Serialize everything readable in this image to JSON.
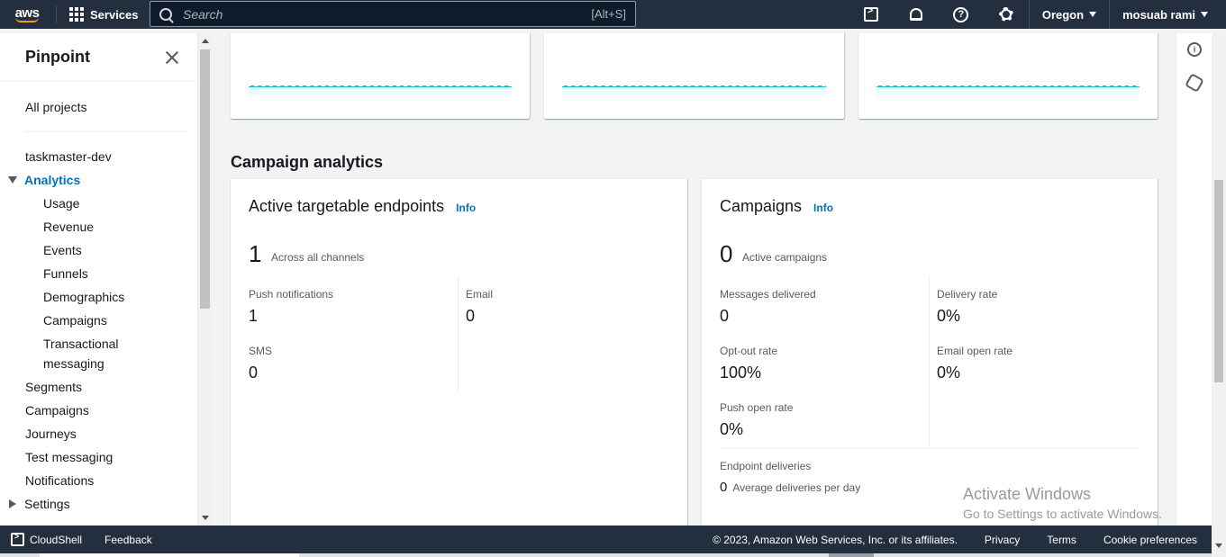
{
  "topnav": {
    "logo_text": "aws",
    "services_label": "Services",
    "search_placeholder": "Search",
    "search_shortcut": "[Alt+S]",
    "region_label": "Oregon",
    "user_label": "mosuab rami",
    "help_glyph": "?"
  },
  "sidebar": {
    "title": "Pinpoint",
    "all_projects": "All projects",
    "project": "taskmaster-dev",
    "analytics_label": "Analytics",
    "analytics_items": [
      "Usage",
      "Revenue",
      "Events",
      "Funnels",
      "Demographics",
      "Campaigns",
      "Transactional",
      "messaging"
    ],
    "items": [
      "Segments",
      "Campaigns",
      "Journeys",
      "Test messaging",
      "Notifications"
    ],
    "settings_label": "Settings"
  },
  "main": {
    "section_title": "Campaign analytics",
    "endpoints_card": {
      "title": "Active targetable endpoints",
      "info": "Info",
      "big_value": "1",
      "big_desc": "Across all channels",
      "metrics": [
        {
          "label": "Push notifications",
          "value": "1"
        },
        {
          "label": "Email",
          "value": "0"
        },
        {
          "label": "SMS",
          "value": "0"
        }
      ]
    },
    "campaigns_card": {
      "title": "Campaigns",
      "info": "Info",
      "big_value": "0",
      "big_desc": "Active campaigns",
      "metrics": [
        {
          "label": "Messages delivered",
          "value": "0"
        },
        {
          "label": "Delivery rate",
          "value": "0%"
        },
        {
          "label": "Opt-out rate",
          "value": "100%"
        },
        {
          "label": "Email open rate",
          "value": "0%"
        },
        {
          "label": "Push open rate",
          "value": "0%"
        }
      ],
      "endpoint_deliveries_label": "Endpoint deliveries",
      "endpoint_deliveries_value": "0",
      "endpoint_deliveries_desc": "Average deliveries per day"
    }
  },
  "rail": {
    "info_glyph": "i"
  },
  "watermark": {
    "line1": "Activate Windows",
    "line2": "Go to Settings to activate Windows."
  },
  "footer": {
    "cloudshell": "CloudShell",
    "feedback": "Feedback",
    "copyright": "© 2023, Amazon Web Services, Inc. or its affiliates.",
    "privacy": "Privacy",
    "terms": "Terms",
    "cookies": "Cookie preferences"
  },
  "colors": {
    "nav_bg": "#232f3e",
    "accent": "#0073bb",
    "sparkline": "#16c2cf"
  }
}
